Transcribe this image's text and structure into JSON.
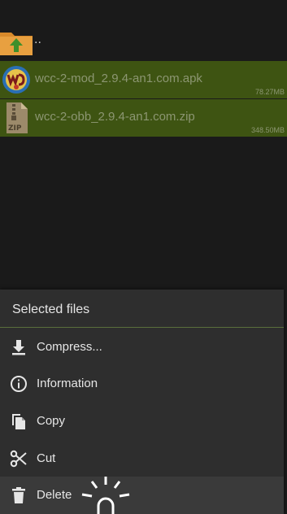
{
  "parent_row": {
    "label": "..",
    "icon": "folder-up-icon"
  },
  "files": [
    {
      "name": "wcc-2-mod_2.9.4-an1.com.apk",
      "size": "78.27MB",
      "icon": "app-icon"
    },
    {
      "name": "wcc-2-obb_2.9.4-an1.com.zip",
      "size": "348.50MB",
      "icon": "zip-icon"
    }
  ],
  "sheet": {
    "title": "Selected files",
    "items": [
      {
        "label": "Compress...",
        "icon": "download-icon"
      },
      {
        "label": "Information",
        "icon": "info-icon"
      },
      {
        "label": "Copy",
        "icon": "copy-icon"
      },
      {
        "label": "Cut",
        "icon": "scissors-icon"
      },
      {
        "label": "Delete",
        "icon": "trash-icon"
      }
    ]
  },
  "colors": {
    "background": "#1a1a1a",
    "selected_row": "#3e5412",
    "sheet": "#2e2e2e",
    "accent_divider": "#5a6e3c"
  }
}
